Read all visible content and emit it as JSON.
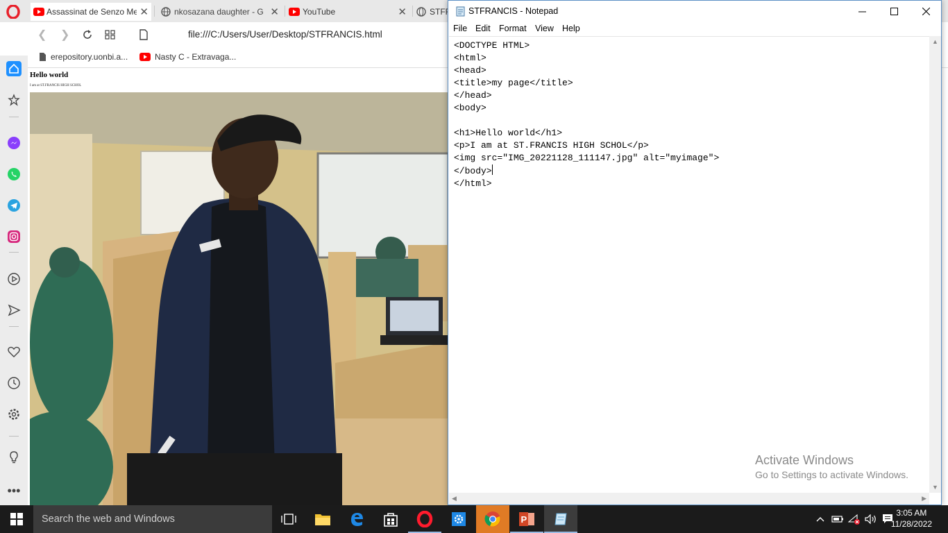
{
  "browser": {
    "tabs": [
      {
        "title": "Assassinat de Senzo Me"
      },
      {
        "title": "nkosazana daughter - G"
      },
      {
        "title": "YouTube"
      },
      {
        "title": "STFR"
      }
    ],
    "url": "file:///C:/Users/User/Desktop/STFRANCIS.html",
    "bookmarks": [
      {
        "label": "erepository.uonbi.a..."
      },
      {
        "label": "Nasty C - Extravaga..."
      }
    ],
    "sidebar_icons": [
      "home-icon",
      "star-icon",
      "messenger-icon",
      "whatsapp-icon",
      "telegram-icon",
      "instagram-icon",
      "player-icon",
      "send-icon",
      "heart-icon",
      "history-icon",
      "settings-icon",
      "lightbulb-icon",
      "more-icon"
    ],
    "page": {
      "heading": "Hello world",
      "paragraph": "I am at ST.FRANCIS HIGH SCHOL"
    }
  },
  "notepad": {
    "title": "STFRANCIS - Notepad",
    "menu": [
      "File",
      "Edit",
      "Format",
      "View",
      "Help"
    ],
    "lines": [
      "<DOCTYPE HTML>",
      "<html>",
      "<head>",
      "<title>my page</title>",
      "</head>",
      "<body>",
      "",
      "<h1>Hello world</h1>",
      "<p>I am at ST.FRANCIS HIGH SCHOL</p>",
      "<img src=\"IMG_20221128_111147.jpg\" alt=\"myimage\">",
      "</body>",
      "</html>"
    ],
    "watermark": {
      "line1": "Activate Windows",
      "line2": "Go to Settings to activate Windows."
    }
  },
  "taskbar": {
    "search_placeholder": "Search the web and Windows",
    "time": "3:05 AM",
    "date": "11/28/2022"
  },
  "colors": {
    "opera_red": "#e8202a",
    "taskbar_bg": "#1b1b1b",
    "notepad_border": "#5a8ec4"
  }
}
